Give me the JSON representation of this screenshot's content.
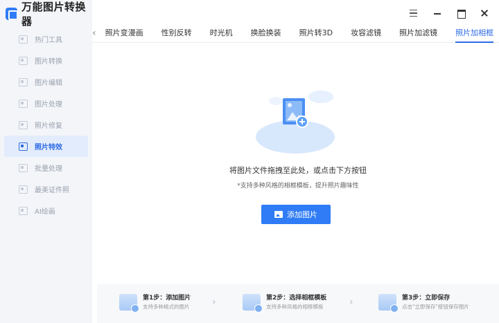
{
  "app": {
    "title": "万能图片转换器"
  },
  "window": {
    "menu_icon": "menu-icon",
    "minimize_icon": "minimize-icon",
    "maximize_icon": "maximize-icon",
    "close_icon": "close-icon"
  },
  "sidebar": {
    "items": [
      {
        "label": "热门工具",
        "icon": "fire-icon",
        "active": false
      },
      {
        "label": "图片转换",
        "icon": "convert-icon",
        "active": false
      },
      {
        "label": "图片编辑",
        "icon": "edit-icon",
        "active": false
      },
      {
        "label": "图片处理",
        "icon": "process-icon",
        "active": false
      },
      {
        "label": "照片修复",
        "icon": "repair-icon",
        "active": false
      },
      {
        "label": "照片特效",
        "icon": "effects-icon",
        "active": true
      },
      {
        "label": "批量处理",
        "icon": "batch-icon",
        "active": false
      },
      {
        "label": "最美证件照",
        "icon": "id-photo-icon",
        "active": false
      },
      {
        "label": "AI绘画",
        "icon": "ai-paint-icon",
        "active": false
      }
    ]
  },
  "tabs": {
    "items": [
      {
        "label": "照片变漫画",
        "active": false
      },
      {
        "label": "性别反转",
        "active": false
      },
      {
        "label": "时光机",
        "active": false
      },
      {
        "label": "换脸换装",
        "active": false
      },
      {
        "label": "照片转3D",
        "active": false
      },
      {
        "label": "妆容滤镜",
        "active": false
      },
      {
        "label": "照片加滤镜",
        "active": false
      },
      {
        "label": "照片加相框",
        "active": true
      }
    ]
  },
  "drop": {
    "title": "将图片文件拖拽至此处，或点击下方按钮",
    "subtitle": "*支持多种风格的相框模板，提升照片趣味性",
    "button_label": "添加图片"
  },
  "steps": [
    {
      "title": "第1步：添加图片",
      "desc": "支持多种格式的图片"
    },
    {
      "title": "第2步：选择相框模板",
      "desc": "支持多种风格的相框模板"
    },
    {
      "title": "第3步：立即保存",
      "desc": "点击\"立即保存\"按钮保存图片"
    }
  ],
  "colors": {
    "accent": "#2f7cf6",
    "sidebar_bg": "#f3f5f9",
    "active_bg": "#e3ecfc"
  }
}
